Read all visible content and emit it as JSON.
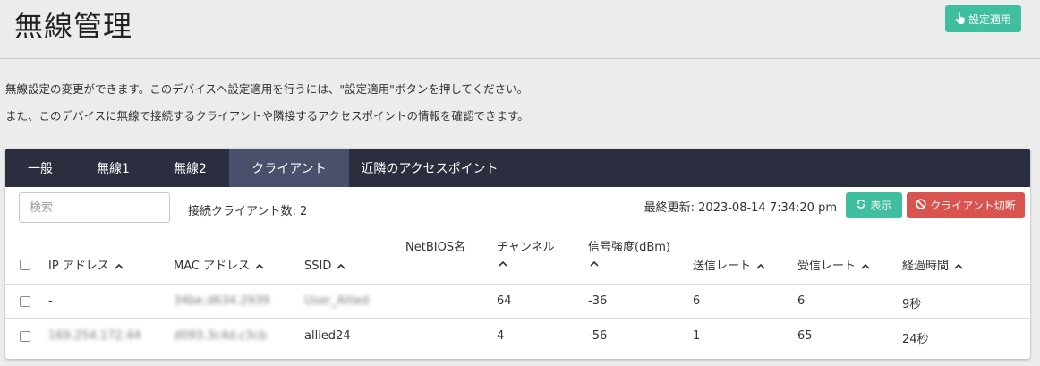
{
  "page": {
    "title": "無線管理",
    "apply_button": "設定適用"
  },
  "description": {
    "line1": "無線設定の変更ができます。このデバイスへ設定適用を行うには、\"設定適用\"ボタンを押してください。",
    "line2": "また、このデバイスに無線で接続するクライアントや隣接するアクセスポイントの情報を確認できます。"
  },
  "tabs": [
    {
      "label": "一般"
    },
    {
      "label": "無線1"
    },
    {
      "label": "無線2"
    },
    {
      "label": "クライアント",
      "active": true
    },
    {
      "label": "近隣のアクセスポイント"
    }
  ],
  "toolbar": {
    "search_placeholder": "検索",
    "client_count": "接続クライアント数: 2",
    "last_updated": "最終更新: 2023-08-14 7:34:20 pm",
    "show_button": "表示",
    "disconnect_button": "クライアント切断"
  },
  "table": {
    "columns": {
      "ip": "IP アドレス",
      "mac": "MAC アドレス",
      "ssid": "SSID",
      "netbios": "NetBIOS名",
      "channel": "チャンネル",
      "signal": "信号強度(dBm)",
      "tx_rate": "送信レート",
      "rx_rate": "受信レート",
      "elapsed": "経過時間"
    },
    "rows": [
      {
        "ip": "-",
        "mac": "34be.d634.2939",
        "ssid": "User_Allied",
        "netbios": "",
        "channel": "64",
        "signal": "-36",
        "tx_rate": "6",
        "rx_rate": "6",
        "elapsed": "9秒"
      },
      {
        "ip": "169.254.172.44",
        "mac": "d093.3c4d.c3cb",
        "ssid": "allied24",
        "netbios": "",
        "channel": "4",
        "signal": "-56",
        "tx_rate": "1",
        "rx_rate": "65",
        "elapsed": "24秒"
      }
    ]
  },
  "colors": {
    "accent": "#3fbf9f",
    "danger": "#d9534f",
    "tabbar": "#2b2e3e",
    "tab_active": "#4a4f6b"
  }
}
